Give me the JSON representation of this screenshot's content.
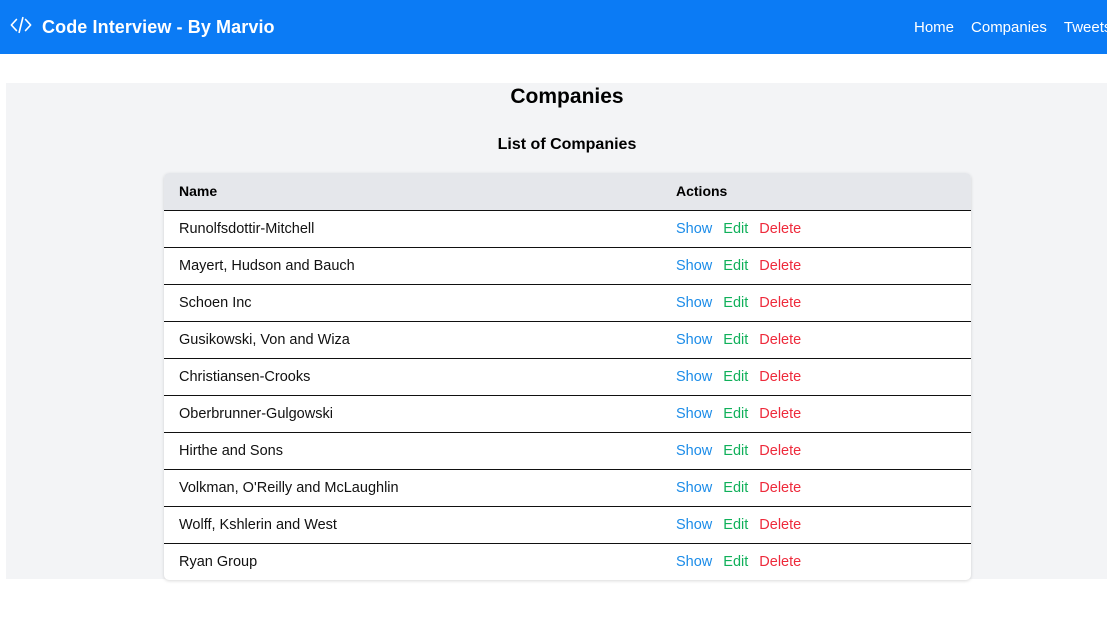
{
  "colors": {
    "navbar": "#0b7bf5",
    "content_bg": "#f3f4f6",
    "show": "#1c8ce8",
    "edit": "#10b05a",
    "delete": "#ee2a3b"
  },
  "navbar": {
    "brand_icon": "code-icon",
    "title": "Code Interview - By Marvio",
    "links": [
      "Home",
      "Companies",
      "Tweets"
    ]
  },
  "main": {
    "title": "Companies",
    "section_title": "List of Companies",
    "table": {
      "headers": {
        "name": "Name",
        "actions": "Actions"
      },
      "action_labels": {
        "show": "Show",
        "edit": "Edit",
        "delete": "Delete"
      },
      "rows": [
        "Runolfsdottir-Mitchell",
        "Mayert, Hudson and Bauch",
        "Schoen Inc",
        "Gusikowski, Von and Wiza",
        "Christiansen-Crooks",
        "Oberbrunner-Gulgowski",
        "Hirthe and Sons",
        "Volkman, O'Reilly and McLaughlin",
        "Wolff, Kshlerin and West",
        "Ryan Group"
      ]
    }
  }
}
